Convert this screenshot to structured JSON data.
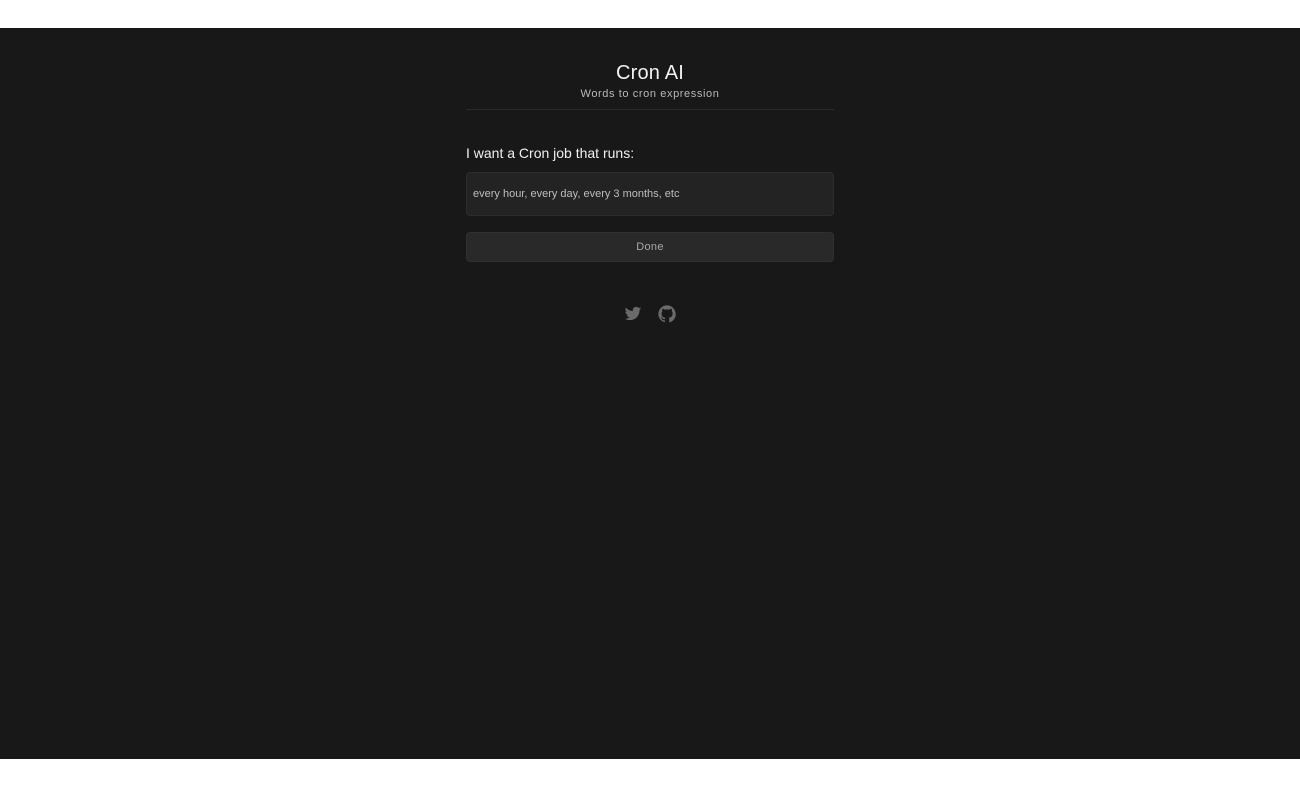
{
  "header": {
    "title": "Cron AI",
    "subtitle": "Words to cron expression"
  },
  "form": {
    "label": "I want a Cron job that runs:",
    "input_placeholder": "every hour, every day, every 3 months, etc",
    "input_value": "",
    "submit_label": "Done"
  },
  "social": {
    "icons": [
      "twitter-icon",
      "github-icon"
    ]
  },
  "colors": {
    "background": "#181818",
    "input_background": "#232323",
    "button_background": "#292929",
    "icon": "#6a6a6a"
  }
}
